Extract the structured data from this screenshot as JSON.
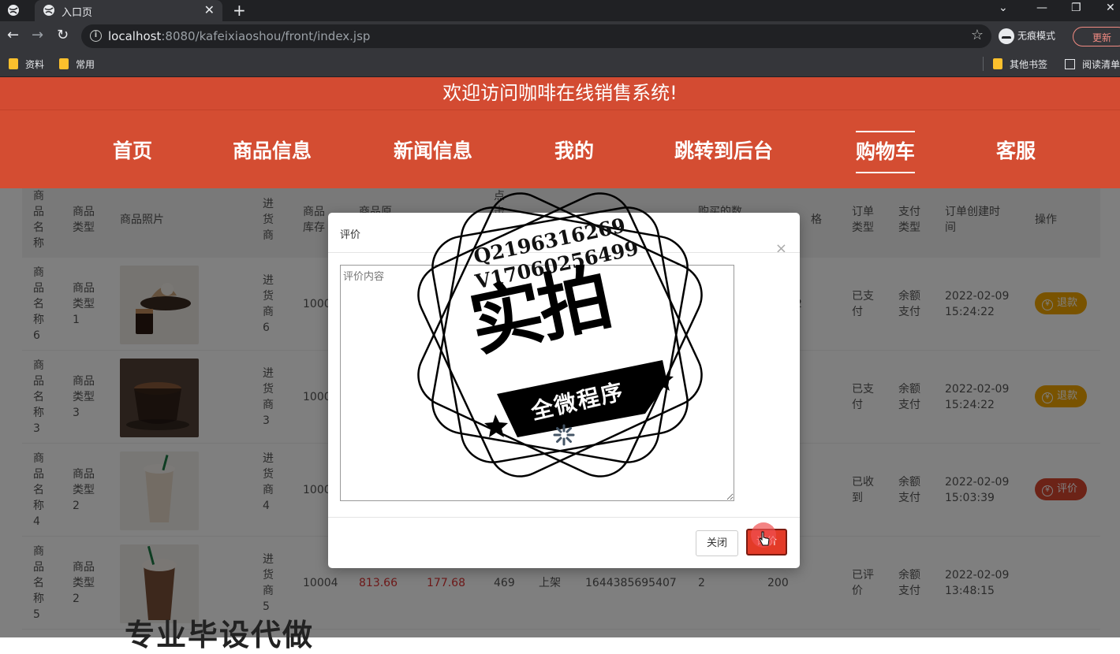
{
  "browser": {
    "tab_title": "入口页",
    "url_host": "localhost",
    "url_rest": ":8080/kafeixiaoshou/front/index.jsp",
    "incognito_label": "无痕模式",
    "update_label": "更新",
    "bookmarks": [
      "资料",
      "常用"
    ],
    "bookmarks_right": [
      "其他书签",
      "阅读清单"
    ]
  },
  "site": {
    "welcome": "欢迎访问咖啡在线销售系统!",
    "nav": [
      "首页",
      "商品信息",
      "新闻信息",
      "我的",
      "跳转到后台",
      "购物车",
      "客服"
    ],
    "active_nav": "购物车"
  },
  "table": {
    "headers": {
      "name": "商品名称",
      "type": "商品类型",
      "photo": "商品照片",
      "supplier": "进货商",
      "stock": "商品库存",
      "orig_price": "商品原",
      "click": "点击",
      "order_no": "",
      "count": "购买的数",
      "price": "格",
      "order_type": "订单类型",
      "pay_type": "支付类型",
      "created": "订单创建时间",
      "action": "操作"
    },
    "rows": [
      {
        "name": "商品名称6",
        "type": "商品类型1",
        "supplier": "进货商6",
        "stock": "1000",
        "orig_price": "",
        "price": "",
        "click": "",
        "status": "",
        "order_no": "",
        "count": "",
        "amount": "2",
        "order_type": "已支付",
        "pay_type": "余额支付",
        "date": "2022-02-09",
        "time": "15:24:22",
        "action": "退款",
        "action_kind": "refund",
        "photo": "coffee-dessert"
      },
      {
        "name": "商品名称3",
        "type": "商品类型3",
        "supplier": "进货商3",
        "stock": "1000",
        "orig_price": "",
        "price": "",
        "click": "",
        "status": "",
        "order_no": "",
        "count": "",
        "amount": "",
        "order_type": "已支付",
        "pay_type": "余额支付",
        "date": "2022-02-09",
        "time": "15:24:22",
        "action": "退款",
        "action_kind": "refund",
        "photo": "coffee-cup"
      },
      {
        "name": "商品名称4",
        "type": "商品类型2",
        "supplier": "进货商4",
        "stock": "1000",
        "orig_price": "",
        "price": "",
        "click": "",
        "status": "",
        "order_no": "",
        "count": "",
        "amount": "",
        "order_type": "已收到",
        "pay_type": "余额支付",
        "date": "2022-02-09",
        "time": "15:03:39",
        "action": "评价",
        "action_kind": "review",
        "photo": "frappe"
      },
      {
        "name": "商品名称5",
        "type": "商品类型2",
        "supplier": "进货商5",
        "stock": "10004",
        "orig_price": "813.66",
        "price": "177.68",
        "click": "469",
        "status": "上架",
        "order_no": "1644385695407",
        "count": "2",
        "amount": "200",
        "order_type": "已评价",
        "pay_type": "余额支付",
        "date": "2022-02-09",
        "time": "13:48:15",
        "action": "",
        "action_kind": "",
        "photo": "iced-latte"
      }
    ]
  },
  "modal": {
    "title": "评价",
    "textarea_placeholder": "评价内容",
    "close_label": "关闭",
    "submit_label": "评价"
  },
  "watermark": {
    "contact_q": "Q2196316269",
    "contact_v": "V17060256499",
    "big": "实拍",
    "banner": "全微程序",
    "bottom": "专业毕设代做"
  }
}
